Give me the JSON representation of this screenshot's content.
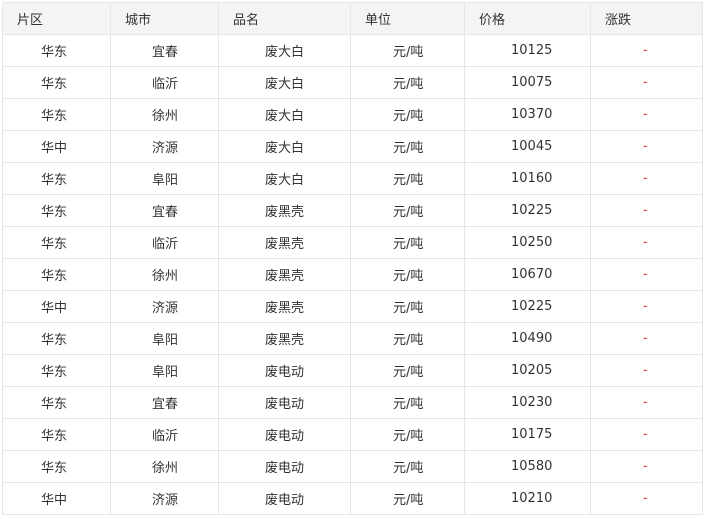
{
  "table": {
    "headers": [
      "片区",
      "城市",
      "品名",
      "单位",
      "价格",
      "涨跌"
    ],
    "rows": [
      [
        "华东",
        "宜春",
        "废大白",
        "元/吨",
        "10125",
        "-"
      ],
      [
        "华东",
        "临沂",
        "废大白",
        "元/吨",
        "10075",
        "-"
      ],
      [
        "华东",
        "徐州",
        "废大白",
        "元/吨",
        "10370",
        "-"
      ],
      [
        "华中",
        "济源",
        "废大白",
        "元/吨",
        "10045",
        "-"
      ],
      [
        "华东",
        "阜阳",
        "废大白",
        "元/吨",
        "10160",
        "-"
      ],
      [
        "华东",
        "宜春",
        "废黑壳",
        "元/吨",
        "10225",
        "-"
      ],
      [
        "华东",
        "临沂",
        "废黑壳",
        "元/吨",
        "10250",
        "-"
      ],
      [
        "华东",
        "徐州",
        "废黑壳",
        "元/吨",
        "10670",
        "-"
      ],
      [
        "华中",
        "济源",
        "废黑壳",
        "元/吨",
        "10225",
        "-"
      ],
      [
        "华东",
        "阜阳",
        "废黑壳",
        "元/吨",
        "10490",
        "-"
      ],
      [
        "华东",
        "阜阳",
        "废电动",
        "元/吨",
        "10205",
        "-"
      ],
      [
        "华东",
        "宜春",
        "废电动",
        "元/吨",
        "10230",
        "-"
      ],
      [
        "华东",
        "临沂",
        "废电动",
        "元/吨",
        "10175",
        "-"
      ],
      [
        "华东",
        "徐州",
        "废电动",
        "元/吨",
        "10580",
        "-"
      ],
      [
        "华中",
        "济源",
        "废电动",
        "元/吨",
        "10210",
        "-"
      ]
    ]
  },
  "colors": {
    "header_bg": "#f4f4f4",
    "border": "#e6e6e6",
    "text": "#333333",
    "change_text": "#e4393c"
  }
}
